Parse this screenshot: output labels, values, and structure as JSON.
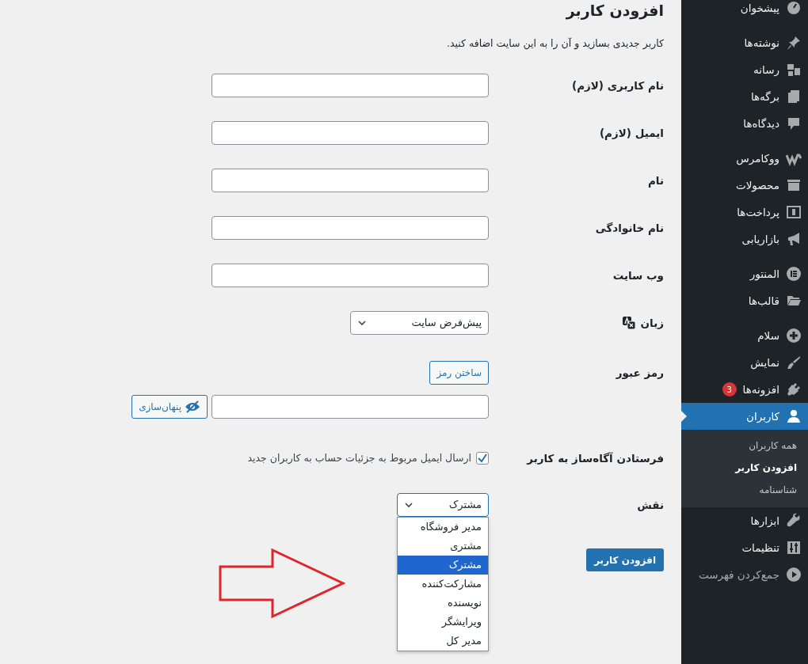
{
  "sidebar": {
    "groups": [
      [
        {
          "label": "پیشخوان",
          "selected": false
        }
      ],
      [
        {
          "label": "نوشته‌ها",
          "selected": false
        },
        {
          "label": "رسانه",
          "selected": false
        },
        {
          "label": "برگه‌ها",
          "selected": false
        },
        {
          "label": "دیدگاه‌ها",
          "selected": false
        }
      ],
      [
        {
          "label": "ووکامرس",
          "selected": false
        },
        {
          "label": "محصولات",
          "selected": false
        },
        {
          "label": "پرداخت‌ها",
          "selected": false
        },
        {
          "label": "بازاریابی",
          "selected": false
        }
      ],
      [
        {
          "label": "المنتور",
          "selected": false
        },
        {
          "label": "قالب‌ها",
          "selected": false
        }
      ],
      [
        {
          "label": "سلام",
          "selected": false
        },
        {
          "label": "نمایش",
          "selected": false
        },
        {
          "label": "افزونه‌ها",
          "selected": false,
          "badge": "3"
        },
        {
          "label": "کاربران",
          "selected": true,
          "children": [
            {
              "label": "همه کاربران",
              "selected": false
            },
            {
              "label": "افزودن کاربر",
              "selected": true
            },
            {
              "label": "شناسنامه",
              "selected": false
            }
          ]
        },
        {
          "label": "ابزارها",
          "selected": false
        },
        {
          "label": "تنظیمات",
          "selected": false
        }
      ]
    ],
    "collapse": "جمع‌کردن فهرست"
  },
  "page": {
    "title": "افزودن کاربر",
    "description": "کاربر جدیدی بسازید و آن را به این سایت اضافه کنید."
  },
  "form": {
    "rows": [
      {
        "kind": "text",
        "label": "نام کاربری (لازم)"
      },
      {
        "kind": "text",
        "label": "ایمیل (لازم)"
      },
      {
        "kind": "text",
        "label": "نام"
      },
      {
        "kind": "text",
        "label": "نام خانوادگی"
      },
      {
        "kind": "text",
        "label": "وب سایت"
      },
      {
        "kind": "select",
        "label": "زبان",
        "value": "پیش‌فرض سایت"
      },
      {
        "kind": "password",
        "label": "رمز عبور",
        "generate_button": "ساختن رمز",
        "hide_button": "پنهان‌سازی"
      },
      {
        "kind": "checkbox",
        "label": "فرستادن آگاه‌ساز به کاربر",
        "checked": true,
        "text": "ارسال ایمیل مربوط به جزئیات حساب به کاربران جدید"
      },
      {
        "kind": "dropdown",
        "label": "نقش",
        "value": "مشترک",
        "expanded": true,
        "options": [
          {
            "label": "مدیر فروشگاه",
            "selected": false
          },
          {
            "label": "مشتری",
            "selected": false
          },
          {
            "label": "مشترک",
            "selected": true
          },
          {
            "label": "مشارکت‌کننده",
            "selected": false
          },
          {
            "label": "نویسنده",
            "selected": false
          },
          {
            "label": "ویرایشگر",
            "selected": false
          },
          {
            "label": "مدیر کل",
            "selected": false
          }
        ]
      }
    ],
    "submit": "افزودن کاربر"
  }
}
